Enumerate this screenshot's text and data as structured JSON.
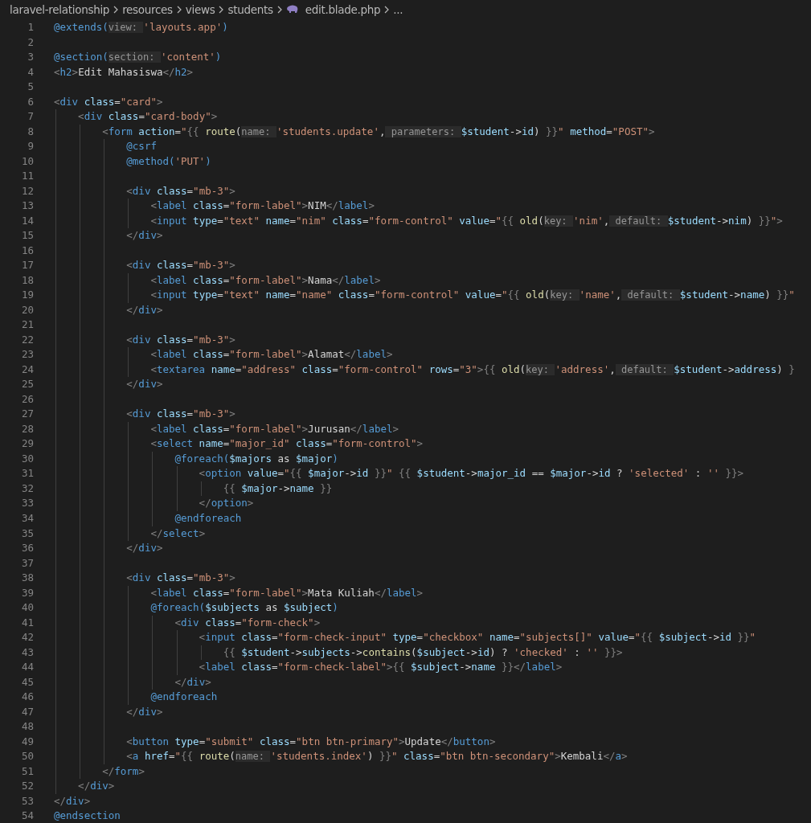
{
  "breadcrumb": [
    {
      "label": "laravel-relationship",
      "kind": "folder"
    },
    {
      "label": "resources",
      "kind": "folder"
    },
    {
      "label": "views",
      "kind": "folder"
    },
    {
      "label": "students",
      "kind": "folder"
    },
    {
      "label": "edit.blade.php",
      "kind": "file"
    },
    {
      "label": "...",
      "kind": "more"
    }
  ],
  "lines": [
    {
      "number": "1",
      "tokens": [
        {
          "kind": "directive",
          "text": "@extends("
        },
        {
          "kind": "hint",
          "text": "view:"
        },
        {
          "kind": "str",
          "text": "'layouts.app'"
        },
        {
          "kind": "directive",
          "text": ")"
        }
      ]
    },
    {
      "number": "2"
    },
    {
      "number": "3",
      "tokens": [
        {
          "kind": "directive",
          "text": "@section("
        },
        {
          "kind": "hint",
          "text": "section:"
        },
        {
          "kind": "str",
          "text": "'content'"
        },
        {
          "kind": "directive",
          "text": ")"
        }
      ]
    },
    {
      "number": "4",
      "tokens": [
        {
          "kind": "punct",
          "text": "<"
        },
        {
          "kind": "tag",
          "text": "h2"
        },
        {
          "kind": "punct",
          "text": ">"
        },
        {
          "kind": "text",
          "text": "Edit Mahasiswa"
        },
        {
          "kind": "punct",
          "text": "</"
        },
        {
          "kind": "tag",
          "text": "h2"
        },
        {
          "kind": "punct",
          "text": ">"
        }
      ]
    },
    {
      "number": "5"
    },
    {
      "number": "6",
      "tokens": [
        {
          "kind": "punct",
          "text": "<"
        },
        {
          "kind": "tag",
          "text": "div"
        },
        {
          "kind": "attr",
          "text": " class"
        },
        {
          "kind": "text",
          "text": "="
        },
        {
          "kind": "str",
          "text": "\"card\""
        },
        {
          "kind": "punct",
          "text": ">"
        }
      ]
    },
    {
      "number": "7",
      "tokens": [
        {
          "kind": "punct",
          "text": "    <"
        },
        {
          "kind": "tag",
          "text": "div"
        },
        {
          "kind": "attr",
          "text": " class"
        },
        {
          "kind": "text",
          "text": "="
        },
        {
          "kind": "str",
          "text": "\"card-body\""
        },
        {
          "kind": "punct",
          "text": ">"
        }
      ]
    },
    {
      "number": "8",
      "tokens": [
        {
          "kind": "punct",
          "text": "        <"
        },
        {
          "kind": "tag",
          "text": "form"
        },
        {
          "kind": "attr",
          "text": " action"
        },
        {
          "kind": "text",
          "text": "="
        },
        {
          "kind": "str",
          "text": "\""
        },
        {
          "kind": "punct",
          "text": "{{"
        },
        {
          "kind": "fn",
          "text": " route"
        },
        {
          "kind": "text",
          "text": "("
        },
        {
          "kind": "hint",
          "text": "name:"
        },
        {
          "kind": "str",
          "text": "'students.update'"
        },
        {
          "kind": "text",
          "text": ","
        },
        {
          "kind": "hint",
          "text": " parameters:"
        },
        {
          "kind": "var",
          "text": "$student"
        },
        {
          "kind": "text",
          "text": "->"
        },
        {
          "kind": "var",
          "text": "id"
        },
        {
          "kind": "text",
          "text": ")"
        },
        {
          "kind": "punct",
          "text": " }}"
        },
        {
          "kind": "str",
          "text": "\""
        },
        {
          "kind": "attr",
          "text": " method"
        },
        {
          "kind": "text",
          "text": "="
        },
        {
          "kind": "str",
          "text": "\"POST\""
        },
        {
          "kind": "punct",
          "text": ">"
        }
      ]
    },
    {
      "number": "9",
      "tokens": [
        {
          "kind": "directive",
          "text": "            @csrf"
        }
      ]
    },
    {
      "number": "10",
      "tokens": [
        {
          "kind": "directive",
          "text": "            @method("
        },
        {
          "kind": "str",
          "text": "'PUT'"
        },
        {
          "kind": "directive",
          "text": ")"
        }
      ]
    },
    {
      "number": "11"
    },
    {
      "number": "12",
      "tokens": [
        {
          "kind": "punct",
          "text": "            <"
        },
        {
          "kind": "tag",
          "text": "div"
        },
        {
          "kind": "attr",
          "text": " class"
        },
        {
          "kind": "text",
          "text": "="
        },
        {
          "kind": "str",
          "text": "\"mb-3\""
        },
        {
          "kind": "punct",
          "text": ">"
        }
      ]
    },
    {
      "number": "13",
      "tokens": [
        {
          "kind": "punct",
          "text": "                <"
        },
        {
          "kind": "tag",
          "text": "label"
        },
        {
          "kind": "attr",
          "text": " class"
        },
        {
          "kind": "text",
          "text": "="
        },
        {
          "kind": "str",
          "text": "\"form-label\""
        },
        {
          "kind": "punct",
          "text": ">"
        },
        {
          "kind": "text",
          "text": "NIM"
        },
        {
          "kind": "punct",
          "text": "</"
        },
        {
          "kind": "tag",
          "text": "label"
        },
        {
          "kind": "punct",
          "text": ">"
        }
      ]
    },
    {
      "number": "14",
      "tokens": [
        {
          "kind": "punct",
          "text": "                <"
        },
        {
          "kind": "tag",
          "text": "input"
        },
        {
          "kind": "attr",
          "text": " type"
        },
        {
          "kind": "text",
          "text": "="
        },
        {
          "kind": "str",
          "text": "\"text\""
        },
        {
          "kind": "attr",
          "text": " name"
        },
        {
          "kind": "text",
          "text": "="
        },
        {
          "kind": "str",
          "text": "\"nim\""
        },
        {
          "kind": "attr",
          "text": " class"
        },
        {
          "kind": "text",
          "text": "="
        },
        {
          "kind": "str",
          "text": "\"form-control\""
        },
        {
          "kind": "attr",
          "text": " value"
        },
        {
          "kind": "text",
          "text": "="
        },
        {
          "kind": "str",
          "text": "\""
        },
        {
          "kind": "punct",
          "text": "{{"
        },
        {
          "kind": "fn",
          "text": " old"
        },
        {
          "kind": "text",
          "text": "("
        },
        {
          "kind": "hint",
          "text": "key:"
        },
        {
          "kind": "str",
          "text": "'nim'"
        },
        {
          "kind": "text",
          "text": ","
        },
        {
          "kind": "hint",
          "text": " default:"
        },
        {
          "kind": "var",
          "text": "$student"
        },
        {
          "kind": "text",
          "text": "->"
        },
        {
          "kind": "var",
          "text": "nim"
        },
        {
          "kind": "text",
          "text": ")"
        },
        {
          "kind": "punct",
          "text": " }}"
        },
        {
          "kind": "str",
          "text": "\""
        },
        {
          "kind": "punct",
          "text": ">"
        }
      ]
    },
    {
      "number": "15",
      "tokens": [
        {
          "kind": "punct",
          "text": "            </"
        },
        {
          "kind": "tag",
          "text": "div"
        },
        {
          "kind": "punct",
          "text": ">"
        }
      ]
    },
    {
      "number": "16"
    },
    {
      "number": "17",
      "tokens": [
        {
          "kind": "punct",
          "text": "            <"
        },
        {
          "kind": "tag",
          "text": "div"
        },
        {
          "kind": "attr",
          "text": " class"
        },
        {
          "kind": "text",
          "text": "="
        },
        {
          "kind": "str",
          "text": "\"mb-3\""
        },
        {
          "kind": "punct",
          "text": ">"
        }
      ]
    },
    {
      "number": "18",
      "tokens": [
        {
          "kind": "punct",
          "text": "                <"
        },
        {
          "kind": "tag",
          "text": "label"
        },
        {
          "kind": "attr",
          "text": " class"
        },
        {
          "kind": "text",
          "text": "="
        },
        {
          "kind": "str",
          "text": "\"form-label\""
        },
        {
          "kind": "punct",
          "text": ">"
        },
        {
          "kind": "text",
          "text": "Nama"
        },
        {
          "kind": "punct",
          "text": "</"
        },
        {
          "kind": "tag",
          "text": "label"
        },
        {
          "kind": "punct",
          "text": ">"
        }
      ]
    },
    {
      "number": "19",
      "tokens": [
        {
          "kind": "punct",
          "text": "                <"
        },
        {
          "kind": "tag",
          "text": "input"
        },
        {
          "kind": "attr",
          "text": " type"
        },
        {
          "kind": "text",
          "text": "="
        },
        {
          "kind": "str",
          "text": "\"text\""
        },
        {
          "kind": "attr",
          "text": " name"
        },
        {
          "kind": "text",
          "text": "="
        },
        {
          "kind": "str",
          "text": "\"name\""
        },
        {
          "kind": "attr",
          "text": " class"
        },
        {
          "kind": "text",
          "text": "="
        },
        {
          "kind": "str",
          "text": "\"form-control\""
        },
        {
          "kind": "attr",
          "text": " value"
        },
        {
          "kind": "text",
          "text": "="
        },
        {
          "kind": "str",
          "text": "\""
        },
        {
          "kind": "punct",
          "text": "{{"
        },
        {
          "kind": "fn",
          "text": " old"
        },
        {
          "kind": "text",
          "text": "("
        },
        {
          "kind": "hint",
          "text": "key:"
        },
        {
          "kind": "str",
          "text": "'name'"
        },
        {
          "kind": "text",
          "text": ","
        },
        {
          "kind": "hint",
          "text": " default:"
        },
        {
          "kind": "var",
          "text": "$student"
        },
        {
          "kind": "text",
          "text": "->"
        },
        {
          "kind": "var",
          "text": "name"
        },
        {
          "kind": "text",
          "text": ")"
        },
        {
          "kind": "punct",
          "text": " }}"
        },
        {
          "kind": "str",
          "text": "\""
        }
      ]
    },
    {
      "number": "20",
      "tokens": [
        {
          "kind": "punct",
          "text": "            </"
        },
        {
          "kind": "tag",
          "text": "div"
        },
        {
          "kind": "punct",
          "text": ">"
        }
      ]
    },
    {
      "number": "21"
    },
    {
      "number": "22",
      "tokens": [
        {
          "kind": "punct",
          "text": "            <"
        },
        {
          "kind": "tag",
          "text": "div"
        },
        {
          "kind": "attr",
          "text": " class"
        },
        {
          "kind": "text",
          "text": "="
        },
        {
          "kind": "str",
          "text": "\"mb-3\""
        },
        {
          "kind": "punct",
          "text": ">"
        }
      ]
    },
    {
      "number": "23",
      "tokens": [
        {
          "kind": "punct",
          "text": "                <"
        },
        {
          "kind": "tag",
          "text": "label"
        },
        {
          "kind": "attr",
          "text": " class"
        },
        {
          "kind": "text",
          "text": "="
        },
        {
          "kind": "str",
          "text": "\"form-label\""
        },
        {
          "kind": "punct",
          "text": ">"
        },
        {
          "kind": "text",
          "text": "Alamat"
        },
        {
          "kind": "punct",
          "text": "</"
        },
        {
          "kind": "tag",
          "text": "label"
        },
        {
          "kind": "punct",
          "text": ">"
        }
      ]
    },
    {
      "number": "24",
      "tokens": [
        {
          "kind": "punct",
          "text": "                <"
        },
        {
          "kind": "tag",
          "text": "textarea"
        },
        {
          "kind": "attr",
          "text": " name"
        },
        {
          "kind": "text",
          "text": "="
        },
        {
          "kind": "str",
          "text": "\"address\""
        },
        {
          "kind": "attr",
          "text": " class"
        },
        {
          "kind": "text",
          "text": "="
        },
        {
          "kind": "str",
          "text": "\"form-control\""
        },
        {
          "kind": "attr",
          "text": " rows"
        },
        {
          "kind": "text",
          "text": "="
        },
        {
          "kind": "str",
          "text": "\"3\""
        },
        {
          "kind": "punct",
          "text": ">{{"
        },
        {
          "kind": "fn",
          "text": " old"
        },
        {
          "kind": "text",
          "text": "("
        },
        {
          "kind": "hint",
          "text": "key:"
        },
        {
          "kind": "str",
          "text": "'address'"
        },
        {
          "kind": "text",
          "text": ","
        },
        {
          "kind": "hint",
          "text": " default:"
        },
        {
          "kind": "var",
          "text": "$student"
        },
        {
          "kind": "text",
          "text": "->"
        },
        {
          "kind": "var",
          "text": "address"
        },
        {
          "kind": "text",
          "text": ")"
        },
        {
          "kind": "punct",
          "text": " }"
        }
      ]
    },
    {
      "number": "25",
      "tokens": [
        {
          "kind": "punct",
          "text": "            </"
        },
        {
          "kind": "tag",
          "text": "div"
        },
        {
          "kind": "punct",
          "text": ">"
        }
      ]
    },
    {
      "number": "26"
    },
    {
      "number": "27",
      "tokens": [
        {
          "kind": "punct",
          "text": "            <"
        },
        {
          "kind": "tag",
          "text": "div"
        },
        {
          "kind": "attr",
          "text": " class"
        },
        {
          "kind": "text",
          "text": "="
        },
        {
          "kind": "str",
          "text": "\"mb-3\""
        },
        {
          "kind": "punct",
          "text": ">"
        }
      ]
    },
    {
      "number": "28",
      "tokens": [
        {
          "kind": "punct",
          "text": "                <"
        },
        {
          "kind": "tag",
          "text": "label"
        },
        {
          "kind": "attr",
          "text": " class"
        },
        {
          "kind": "text",
          "text": "="
        },
        {
          "kind": "str",
          "text": "\"form-label\""
        },
        {
          "kind": "punct",
          "text": ">"
        },
        {
          "kind": "text",
          "text": "Jurusan"
        },
        {
          "kind": "punct",
          "text": "</"
        },
        {
          "kind": "tag",
          "text": "label"
        },
        {
          "kind": "punct",
          "text": ">"
        }
      ]
    },
    {
      "number": "29",
      "tokens": [
        {
          "kind": "punct",
          "text": "                <"
        },
        {
          "kind": "tag",
          "text": "select"
        },
        {
          "kind": "attr",
          "text": " name"
        },
        {
          "kind": "text",
          "text": "="
        },
        {
          "kind": "str",
          "text": "\"major_id\""
        },
        {
          "kind": "attr",
          "text": " class"
        },
        {
          "kind": "text",
          "text": "="
        },
        {
          "kind": "str",
          "text": "\"form-control\""
        },
        {
          "kind": "punct",
          "text": ">"
        }
      ]
    },
    {
      "number": "30",
      "tokens": [
        {
          "kind": "directive",
          "text": "                    @foreach("
        },
        {
          "kind": "var",
          "text": "$majors"
        },
        {
          "kind": "text",
          "text": " as "
        },
        {
          "kind": "var",
          "text": "$major"
        },
        {
          "kind": "directive",
          "text": ")"
        }
      ]
    },
    {
      "number": "31",
      "tokens": [
        {
          "kind": "punct",
          "text": "                        <"
        },
        {
          "kind": "tag",
          "text": "option"
        },
        {
          "kind": "attr",
          "text": " value"
        },
        {
          "kind": "text",
          "text": "="
        },
        {
          "kind": "str",
          "text": "\""
        },
        {
          "kind": "punct",
          "text": "{{"
        },
        {
          "kind": "var",
          "text": " $major"
        },
        {
          "kind": "text",
          "text": "->"
        },
        {
          "kind": "var",
          "text": "id"
        },
        {
          "kind": "punct",
          "text": " }}"
        },
        {
          "kind": "str",
          "text": "\""
        },
        {
          "kind": "punct",
          "text": " {{"
        },
        {
          "kind": "var",
          "text": " $student"
        },
        {
          "kind": "text",
          "text": "->"
        },
        {
          "kind": "var",
          "text": "major_id"
        },
        {
          "kind": "text",
          "text": " == "
        },
        {
          "kind": "var",
          "text": "$major"
        },
        {
          "kind": "text",
          "text": "->"
        },
        {
          "kind": "var",
          "text": "id"
        },
        {
          "kind": "text",
          "text": " ? "
        },
        {
          "kind": "str",
          "text": "'selected'"
        },
        {
          "kind": "text",
          "text": " : "
        },
        {
          "kind": "str",
          "text": "''"
        },
        {
          "kind": "punct",
          "text": " }}>"
        }
      ]
    },
    {
      "number": "32",
      "tokens": [
        {
          "kind": "punct",
          "text": "                            {{"
        },
        {
          "kind": "var",
          "text": " $major"
        },
        {
          "kind": "text",
          "text": "->"
        },
        {
          "kind": "var",
          "text": "name"
        },
        {
          "kind": "punct",
          "text": " }}"
        }
      ]
    },
    {
      "number": "33",
      "tokens": [
        {
          "kind": "punct",
          "text": "                        </"
        },
        {
          "kind": "tag",
          "text": "option"
        },
        {
          "kind": "punct",
          "text": ">"
        }
      ]
    },
    {
      "number": "34",
      "tokens": [
        {
          "kind": "directive",
          "text": "                    @endforeach"
        }
      ]
    },
    {
      "number": "35",
      "tokens": [
        {
          "kind": "punct",
          "text": "                </"
        },
        {
          "kind": "tag",
          "text": "select"
        },
        {
          "kind": "punct",
          "text": ">"
        }
      ]
    },
    {
      "number": "36",
      "tokens": [
        {
          "kind": "punct",
          "text": "            </"
        },
        {
          "kind": "tag",
          "text": "div"
        },
        {
          "kind": "punct",
          "text": ">"
        }
      ]
    },
    {
      "number": "37"
    },
    {
      "number": "38",
      "tokens": [
        {
          "kind": "punct",
          "text": "            <"
        },
        {
          "kind": "tag",
          "text": "div"
        },
        {
          "kind": "attr",
          "text": " class"
        },
        {
          "kind": "text",
          "text": "="
        },
        {
          "kind": "str",
          "text": "\"mb-3\""
        },
        {
          "kind": "punct",
          "text": ">"
        }
      ]
    },
    {
      "number": "39",
      "tokens": [
        {
          "kind": "punct",
          "text": "                <"
        },
        {
          "kind": "tag",
          "text": "label"
        },
        {
          "kind": "attr",
          "text": " class"
        },
        {
          "kind": "text",
          "text": "="
        },
        {
          "kind": "str",
          "text": "\"form-label\""
        },
        {
          "kind": "punct",
          "text": ">"
        },
        {
          "kind": "text",
          "text": "Mata Kuliah"
        },
        {
          "kind": "punct",
          "text": "</"
        },
        {
          "kind": "tag",
          "text": "label"
        },
        {
          "kind": "punct",
          "text": ">"
        }
      ]
    },
    {
      "number": "40",
      "tokens": [
        {
          "kind": "directive",
          "text": "                @foreach("
        },
        {
          "kind": "var",
          "text": "$subjects"
        },
        {
          "kind": "text",
          "text": " as "
        },
        {
          "kind": "var",
          "text": "$subject"
        },
        {
          "kind": "directive",
          "text": ")"
        }
      ]
    },
    {
      "number": "41",
      "tokens": [
        {
          "kind": "punct",
          "text": "                    <"
        },
        {
          "kind": "tag",
          "text": "div"
        },
        {
          "kind": "attr",
          "text": " class"
        },
        {
          "kind": "text",
          "text": "="
        },
        {
          "kind": "str",
          "text": "\"form-check\""
        },
        {
          "kind": "punct",
          "text": ">"
        }
      ]
    },
    {
      "number": "42",
      "tokens": [
        {
          "kind": "punct",
          "text": "                        <"
        },
        {
          "kind": "tag",
          "text": "input"
        },
        {
          "kind": "attr",
          "text": " class"
        },
        {
          "kind": "text",
          "text": "="
        },
        {
          "kind": "str",
          "text": "\"form-check-input\""
        },
        {
          "kind": "attr",
          "text": " type"
        },
        {
          "kind": "text",
          "text": "="
        },
        {
          "kind": "str",
          "text": "\"checkbox\""
        },
        {
          "kind": "attr",
          "text": " name"
        },
        {
          "kind": "text",
          "text": "="
        },
        {
          "kind": "str",
          "text": "\"subjects[]\""
        },
        {
          "kind": "attr",
          "text": " value"
        },
        {
          "kind": "text",
          "text": "="
        },
        {
          "kind": "str",
          "text": "\""
        },
        {
          "kind": "punct",
          "text": "{{"
        },
        {
          "kind": "var",
          "text": " $subject"
        },
        {
          "kind": "text",
          "text": "->"
        },
        {
          "kind": "var",
          "text": "id"
        },
        {
          "kind": "punct",
          "text": " }}"
        },
        {
          "kind": "str",
          "text": "\""
        }
      ]
    },
    {
      "number": "43",
      "tokens": [
        {
          "kind": "punct",
          "text": "                            {{"
        },
        {
          "kind": "var",
          "text": " $student"
        },
        {
          "kind": "text",
          "text": "->"
        },
        {
          "kind": "var",
          "text": "subjects"
        },
        {
          "kind": "text",
          "text": "->"
        },
        {
          "kind": "fn",
          "text": "contains"
        },
        {
          "kind": "text",
          "text": "("
        },
        {
          "kind": "var",
          "text": "$subject"
        },
        {
          "kind": "text",
          "text": "->"
        },
        {
          "kind": "var",
          "text": "id"
        },
        {
          "kind": "text",
          "text": ") ? "
        },
        {
          "kind": "str",
          "text": "'checked'"
        },
        {
          "kind": "text",
          "text": " : "
        },
        {
          "kind": "str",
          "text": "''"
        },
        {
          "kind": "punct",
          "text": " }}>"
        }
      ]
    },
    {
      "number": "44",
      "tokens": [
        {
          "kind": "punct",
          "text": "                        <"
        },
        {
          "kind": "tag",
          "text": "label"
        },
        {
          "kind": "attr",
          "text": " class"
        },
        {
          "kind": "text",
          "text": "="
        },
        {
          "kind": "str",
          "text": "\"form-check-label\""
        },
        {
          "kind": "punct",
          "text": ">{{"
        },
        {
          "kind": "var",
          "text": " $subject"
        },
        {
          "kind": "text",
          "text": "->"
        },
        {
          "kind": "var",
          "text": "name"
        },
        {
          "kind": "punct",
          "text": " }}</"
        },
        {
          "kind": "tag",
          "text": "label"
        },
        {
          "kind": "punct",
          "text": ">"
        }
      ]
    },
    {
      "number": "45",
      "tokens": [
        {
          "kind": "punct",
          "text": "                    </"
        },
        {
          "kind": "tag",
          "text": "div"
        },
        {
          "kind": "punct",
          "text": ">"
        }
      ]
    },
    {
      "number": "46",
      "tokens": [
        {
          "kind": "directive",
          "text": "                @endforeach"
        }
      ]
    },
    {
      "number": "47",
      "tokens": [
        {
          "kind": "punct",
          "text": "            </"
        },
        {
          "kind": "tag",
          "text": "div"
        },
        {
          "kind": "punct",
          "text": ">"
        }
      ]
    },
    {
      "number": "48"
    },
    {
      "number": "49",
      "tokens": [
        {
          "kind": "punct",
          "text": "            <"
        },
        {
          "kind": "tag",
          "text": "button"
        },
        {
          "kind": "attr",
          "text": " type"
        },
        {
          "kind": "text",
          "text": "="
        },
        {
          "kind": "str",
          "text": "\"submit\""
        },
        {
          "kind": "attr",
          "text": " class"
        },
        {
          "kind": "text",
          "text": "="
        },
        {
          "kind": "str",
          "text": "\"btn btn-primary\""
        },
        {
          "kind": "punct",
          "text": ">"
        },
        {
          "kind": "text",
          "text": "Update"
        },
        {
          "kind": "punct",
          "text": "</"
        },
        {
          "kind": "tag",
          "text": "button"
        },
        {
          "kind": "punct",
          "text": ">"
        }
      ]
    },
    {
      "number": "50",
      "tokens": [
        {
          "kind": "punct",
          "text": "            <"
        },
        {
          "kind": "tag",
          "text": "a"
        },
        {
          "kind": "attr",
          "text": " href"
        },
        {
          "kind": "text",
          "text": "="
        },
        {
          "kind": "str",
          "text": "\""
        },
        {
          "kind": "punct",
          "text": "{{"
        },
        {
          "kind": "fn",
          "text": " route"
        },
        {
          "kind": "text",
          "text": "("
        },
        {
          "kind": "hint",
          "text": "name:"
        },
        {
          "kind": "str",
          "text": "'students.index'"
        },
        {
          "kind": "text",
          "text": ")"
        },
        {
          "kind": "punct",
          "text": " }}"
        },
        {
          "kind": "str",
          "text": "\""
        },
        {
          "kind": "attr",
          "text": " class"
        },
        {
          "kind": "text",
          "text": "="
        },
        {
          "kind": "str",
          "text": "\"btn btn-secondary\""
        },
        {
          "kind": "punct",
          "text": ">"
        },
        {
          "kind": "text",
          "text": "Kembali"
        },
        {
          "kind": "punct",
          "text": "</"
        },
        {
          "kind": "tag",
          "text": "a"
        },
        {
          "kind": "punct",
          "text": ">"
        }
      ]
    },
    {
      "number": "51",
      "tokens": [
        {
          "kind": "punct",
          "text": "        </"
        },
        {
          "kind": "tag",
          "text": "form"
        },
        {
          "kind": "punct",
          "text": ">"
        }
      ]
    },
    {
      "number": "52",
      "tokens": [
        {
          "kind": "punct",
          "text": "    </"
        },
        {
          "kind": "tag",
          "text": "div"
        },
        {
          "kind": "punct",
          "text": ">"
        }
      ]
    },
    {
      "number": "53",
      "tokens": [
        {
          "kind": "punct",
          "text": "</"
        },
        {
          "kind": "tag",
          "text": "div"
        },
        {
          "kind": "punct",
          "text": ">"
        }
      ]
    },
    {
      "number": "54",
      "tokens": [
        {
          "kind": "directive",
          "text": "@endsection"
        }
      ]
    }
  ]
}
